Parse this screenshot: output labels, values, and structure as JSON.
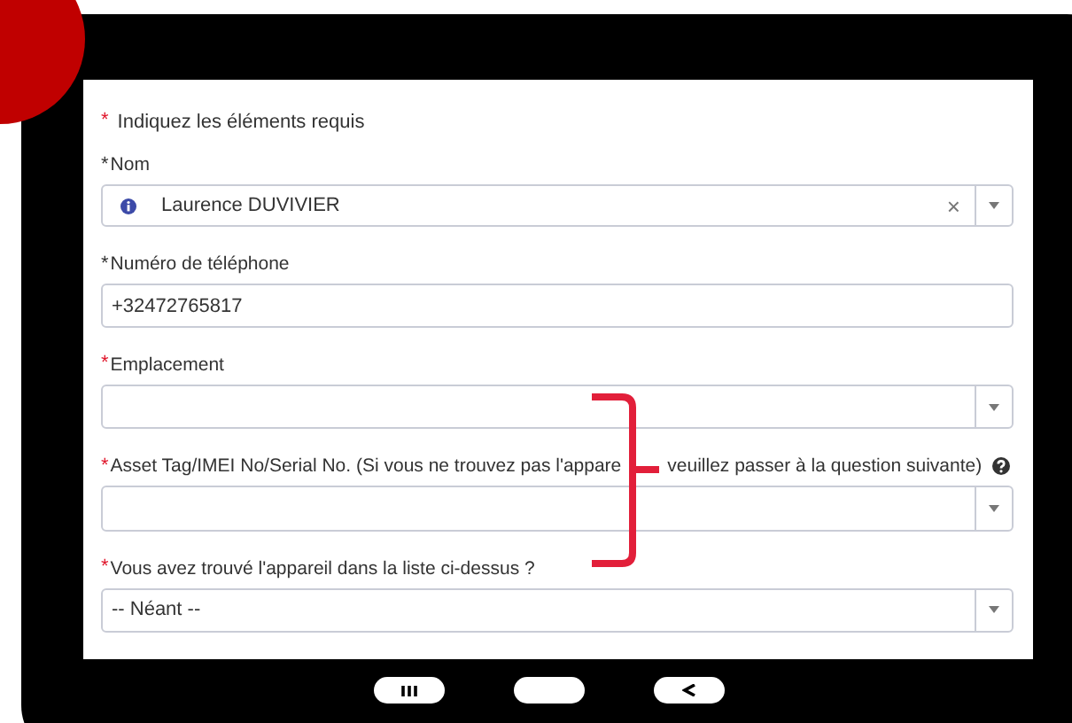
{
  "required_note": {
    "marker": "*",
    "text": "Indiquez les éléments requis"
  },
  "fields": [
    {
      "kind": "lookup",
      "marker": "*",
      "satisfied": true,
      "label": "Nom",
      "value": "Laurence DUVIVIER",
      "clear": "×",
      "help": false
    },
    {
      "kind": "text",
      "marker": "*",
      "satisfied": true,
      "label": "Numéro de téléphone",
      "value": "+32472765817",
      "help": false
    },
    {
      "kind": "select",
      "marker": "*",
      "satisfied": false,
      "label": "Emplacement",
      "help": false
    },
    {
      "kind": "select",
      "marker": "*",
      "satisfied": false,
      "label_parts": [
        "Asset Tag/IMEI No/Serial No. (Si vous ne trouvez pas l'appare",
        "veuillez passer à la question suivante)"
      ],
      "help": true
    },
    {
      "kind": "select",
      "marker": "*",
      "satisfied": false,
      "label": "Vous avez trouvé l'appareil dans la liste ci-dessus ?",
      "value": "-- Néant --",
      "help": false
    }
  ]
}
